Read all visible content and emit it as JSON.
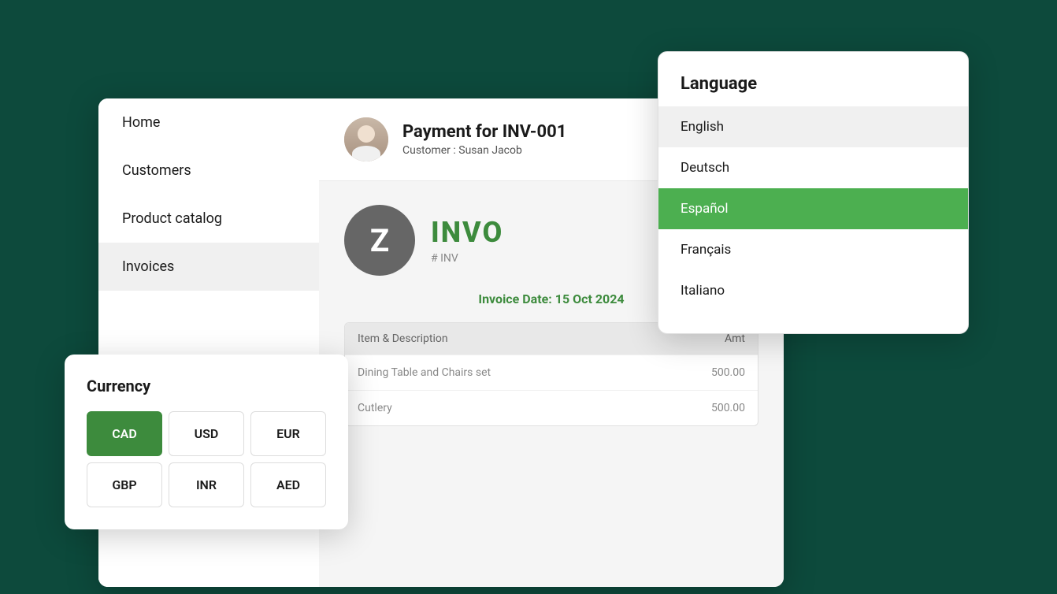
{
  "sidebar": {
    "items": [
      {
        "label": "Home",
        "active": false
      },
      {
        "label": "Customers",
        "active": false
      },
      {
        "label": "Product catalog",
        "active": false
      },
      {
        "label": "Invoices",
        "active": true
      }
    ]
  },
  "payment_header": {
    "title": "Payment for INV-001",
    "customer": "Customer : Susan Jacob"
  },
  "invoice": {
    "logo_letter": "Z",
    "title": "INVO",
    "number": "# INV",
    "date_label": "Invoice Date: 15 Oct 2024",
    "table": {
      "col_desc": "Item & Description",
      "col_amt": "Amt",
      "rows": [
        {
          "desc": "Dining Table and Chairs set",
          "amt": "500.00"
        },
        {
          "desc": "Cutlery",
          "amt": "500.00"
        }
      ]
    }
  },
  "currency_popup": {
    "title": "Currency",
    "currencies": [
      {
        "code": "CAD",
        "active": true
      },
      {
        "code": "USD",
        "active": false
      },
      {
        "code": "EUR",
        "active": false
      },
      {
        "code": "GBP",
        "active": false
      },
      {
        "code": "INR",
        "active": false
      },
      {
        "code": "AED",
        "active": false
      }
    ]
  },
  "language_popup": {
    "title": "Language",
    "languages": [
      {
        "label": "English",
        "selected": true,
        "active": false
      },
      {
        "label": "Deutsch",
        "selected": false,
        "active": false
      },
      {
        "label": "Español",
        "selected": false,
        "active": true
      },
      {
        "label": "Français",
        "selected": false,
        "active": false
      },
      {
        "label": "Italiano",
        "selected": false,
        "active": false
      }
    ]
  }
}
